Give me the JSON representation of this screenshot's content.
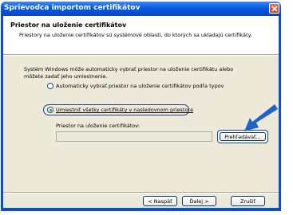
{
  "window": {
    "title": "Sprievodca importom certifikátov"
  },
  "header": {
    "title": "Priestor na uloženie certifikátov",
    "subtitle": "Priestory na uloženie certifikátov sú systémové oblasti, do ktorých sa ukladajú certifikáty."
  },
  "body": {
    "description_line1": "Systém Windows môže automaticky vybrať priestor na uloženie certifikátu alebo",
    "description_line2": "môžete zadať jeho umiestnenie.",
    "radio_auto_label": "Automaticky vybrať priestor na uloženie certifikátov podľa typov",
    "radio_manual_label": "Umiestniť všetky certifikáty v nasledovnom priestore",
    "selected_option": "manual",
    "store_label": "Priestor na uloženie certifikátov:",
    "store_value": "",
    "browse_label": "Prehľadávať..."
  },
  "footer": {
    "back_label": "< Naspäť",
    "next_label": "Ďalej >",
    "cancel_label": "Zrušiť"
  },
  "colors": {
    "titlebar": "#0a57df",
    "arrow": "#1e63c8",
    "highlight": "#1f3f8f"
  }
}
